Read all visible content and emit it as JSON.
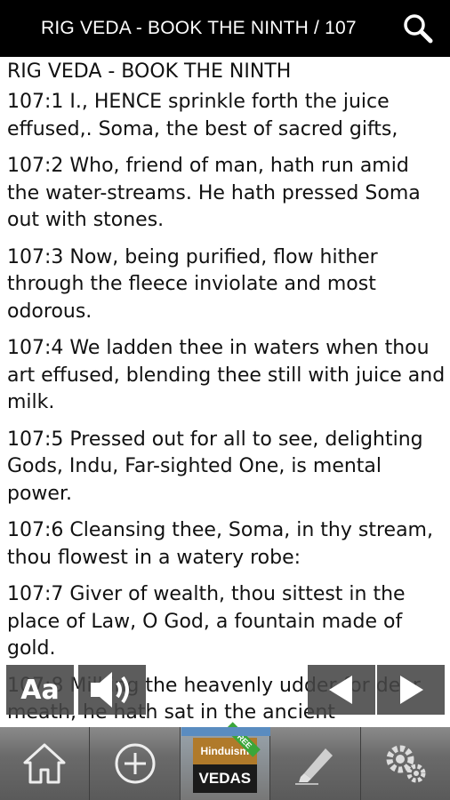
{
  "header": {
    "title": "RIG VEDA - BOOK THE NINTH / 107",
    "search_icon": "search-icon"
  },
  "content": {
    "book_heading": "RIG VEDA - BOOK THE NINTH",
    "verses": [
      "107:1 I., HENCE sprinkle forth the juice effused,. Soma, the best of sacred gifts,",
      "107:2 Who, friend of man, hath run amid the water-streams. He hath pressed Soma out with stones.",
      "107:3 Now, being purified, flow hither through the fleece inviolate and most odorous.",
      "107:4 We ladden thee in waters when thou art effused, blending thee still with juice and milk.",
      "107:5 Pressed out for all to see, delighting Gods, Indu, Far-sighted One, is mental power.",
      "107:6 Cleansing thee, Soma, in thy stream, thou flowest in a watery robe:",
      "107:7 Giver of wealth, thou sittest in the place of Law, O God, a fountain made of gold.",
      "107:8 Milking the heavenly udder for dear meath, he hath sat in the ancient"
    ]
  },
  "controls": {
    "font_label": "Aa",
    "audio_icon": "speaker-icon",
    "prev_icon": "arrow-left-icon",
    "next_icon": "arrow-right-icon"
  },
  "navbar": {
    "items": [
      {
        "icon": "home-icon"
      },
      {
        "icon": "add-circle-icon"
      },
      {
        "icon": "vedas-logo",
        "logo_top": "Hinduism",
        "logo_bottom": "VEDAS",
        "ribbon": "FREE"
      },
      {
        "icon": "highlighter-icon"
      },
      {
        "icon": "gears-icon"
      }
    ]
  },
  "colors": {
    "titlebar_bg": "#000000",
    "control_bg": "#464646",
    "nav_accent": "#5a8cc0"
  }
}
